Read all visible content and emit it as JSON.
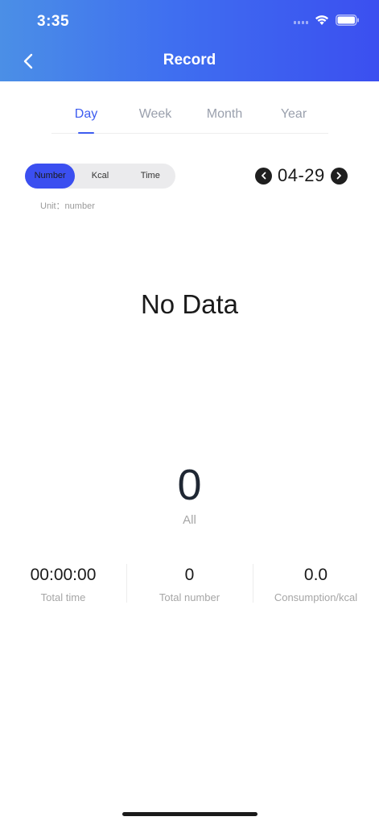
{
  "status_bar": {
    "time": "3:35"
  },
  "header": {
    "title": "Record",
    "back_icon": "chevron-left-icon"
  },
  "tabs": [
    {
      "label": "Day",
      "active": true
    },
    {
      "label": "Week",
      "active": false
    },
    {
      "label": "Month",
      "active": false
    },
    {
      "label": "Year",
      "active": false
    }
  ],
  "metric_toggle": {
    "options": [
      "Number",
      "Kcal",
      "Time"
    ],
    "selected": "Number"
  },
  "unit_label": "Unit：number",
  "date_nav": {
    "date": "04-29"
  },
  "empty_state": "No Data",
  "summary": {
    "all_value": "0",
    "all_label": "All"
  },
  "stats": [
    {
      "value": "00:00:00",
      "label": "Total time"
    },
    {
      "value": "0",
      "label": "Total number"
    },
    {
      "value": "0.0",
      "label": "Consumption/kcal"
    }
  ],
  "colors": {
    "accent": "#3d5cf0",
    "header_start": "#4b8fe6",
    "header_end": "#3b4ff0"
  }
}
